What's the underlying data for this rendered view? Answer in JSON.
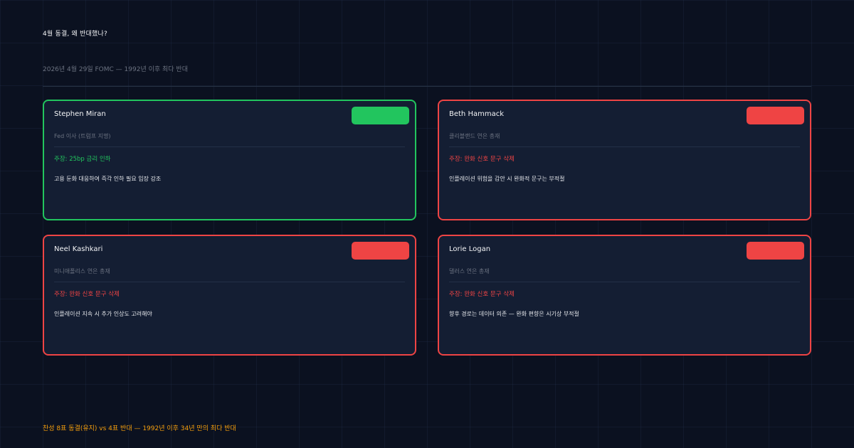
{
  "header": {
    "title": "4월 동결, 왜 반대했나?",
    "subtitle": "2026년 4월 29일 FOMC — 1992년 이후 최다 반대"
  },
  "colors": {
    "background": "#0b1120",
    "card": "#141e33",
    "cut": "#22c55e",
    "hawk": "#ef4444",
    "footer": "#f59e0b"
  },
  "cards": [
    {
      "name": "Stephen Miran",
      "role": "Fed 이사 (트럼프 지명)",
      "stance": "주장: 25bp 금리 인하",
      "reason": "고용 둔화 대응하여 즉각 인하 필요 입장 강조",
      "badge_color": "#22c55e"
    },
    {
      "name": "Beth Hammack",
      "role": "클리블랜드 연은 총재",
      "stance": "주장: 완화 신호 문구 삭제",
      "reason": "인플레이션 위험을 감안 시 완화적 문구는 부적절",
      "badge_color": "#ef4444"
    },
    {
      "name": "Neel Kashkari",
      "role": "미니애폴리스 연은 총재",
      "stance": "주장: 완화 신호 문구 삭제",
      "reason": "인플레이션 지속 시 추가 인상도 고려해야",
      "badge_color": "#ef4444"
    },
    {
      "name": "Lorie Logan",
      "role": "댈러스 연은 총재",
      "stance": "주장: 완화 신호 문구 삭제",
      "reason": "향후 경로는 데이터 의존 — 완화 편향은 시기상 부적절",
      "badge_color": "#ef4444"
    }
  ],
  "footer": {
    "text": "찬성 8표 동결(유지) vs 4표 반대 — 1992년 이후 34년 만의 최다 반대"
  }
}
